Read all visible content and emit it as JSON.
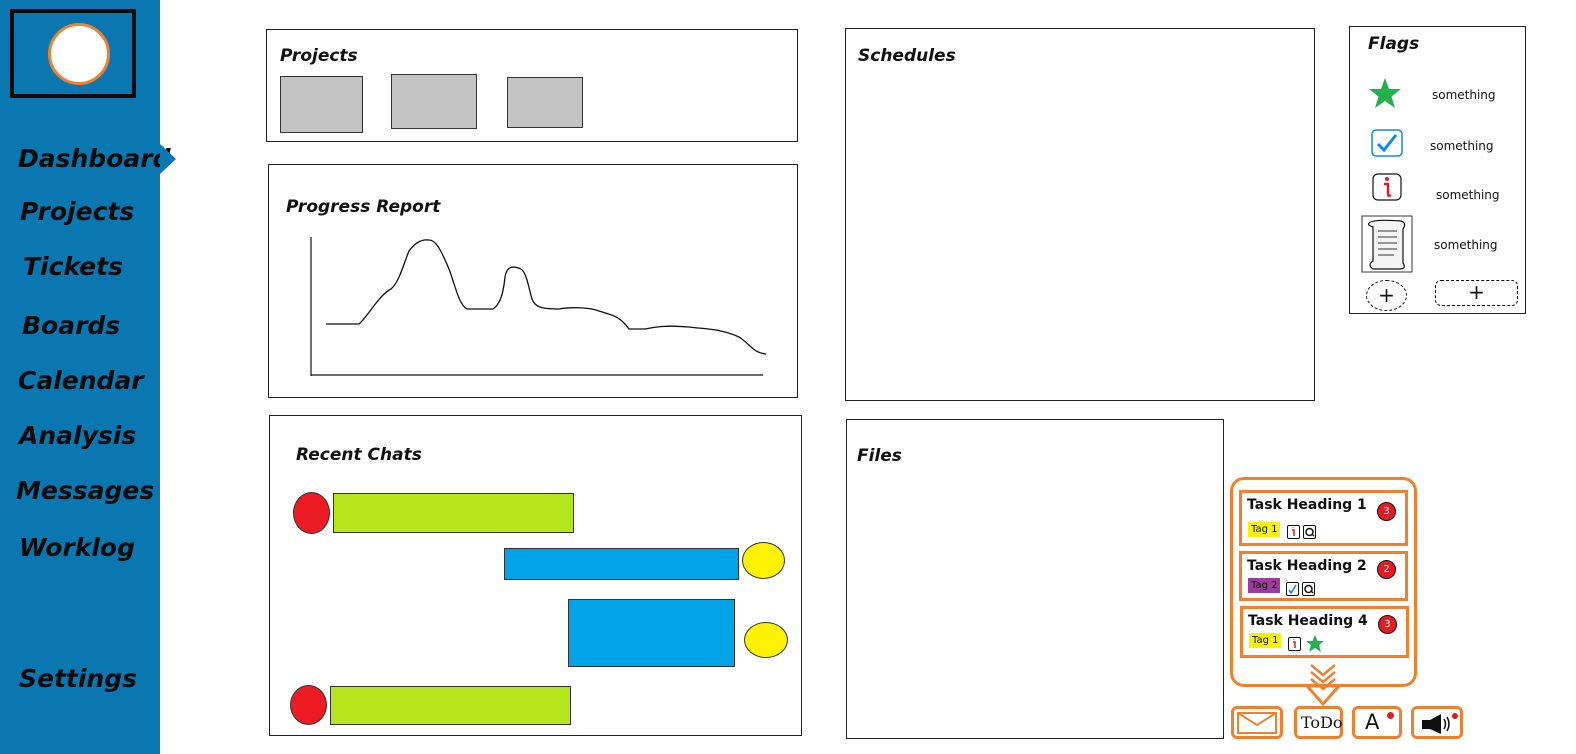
{
  "sidebar": {
    "items": [
      {
        "label": "Dashboard"
      },
      {
        "label": "Projects"
      },
      {
        "label": "Tickets"
      },
      {
        "label": "Boards"
      },
      {
        "label": "Calendar"
      },
      {
        "label": "Analysis"
      },
      {
        "label": "Messages"
      },
      {
        "label": "Worklog"
      },
      {
        "label": "Settings"
      }
    ],
    "active": "Dashboard"
  },
  "projects": {
    "title": "Projects"
  },
  "progress": {
    "title": "Progress Report"
  },
  "chats": {
    "title": "Recent Chats"
  },
  "schedules": {
    "title": "Schedules"
  },
  "files": {
    "title": "Files"
  },
  "flags": {
    "title": "Flags",
    "items": [
      {
        "icon": "star-icon",
        "label": "something"
      },
      {
        "icon": "checkmark-icon",
        "label": "something"
      },
      {
        "icon": "info-icon",
        "label": "something"
      },
      {
        "icon": "scroll-icon",
        "label": "something"
      }
    ],
    "add_symbol": "+"
  },
  "tasks": {
    "items": [
      {
        "title": "Task Heading 1",
        "count": "3",
        "tag": "Tag 1",
        "tag_color": "#f7f20a"
      },
      {
        "title": "Task Heading 2",
        "count": "2",
        "tag": "Tag 2",
        "tag_color": "#9b3d9b"
      },
      {
        "title": "Task Heading 4",
        "count": "3",
        "tag": "Tag 1",
        "tag_color": "#f7f20a"
      }
    ],
    "todo_label": "ToDo",
    "alert_label": "A"
  },
  "colors": {
    "sidebar": "#0a77b0",
    "accent": "#f08030",
    "green_bar": "#b5e61d",
    "blue_bar": "#00a2e8",
    "red_dot": "#ed1c24",
    "yellow_dot": "#fff200"
  }
}
